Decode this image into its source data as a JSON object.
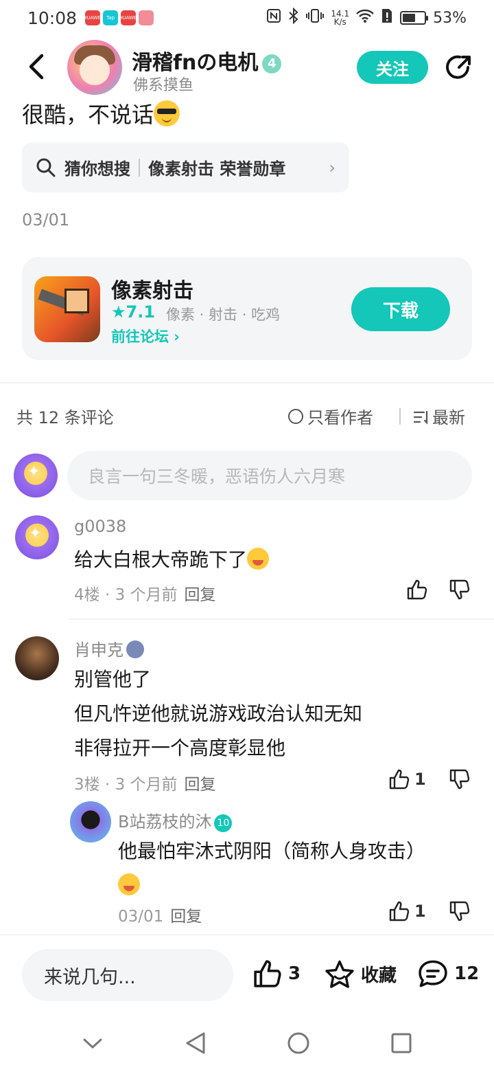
{
  "status_bar": {
    "time": "10:08",
    "net_speed_value": "14.1",
    "net_speed_unit": "K/s",
    "battery": "53%",
    "apps": [
      {
        "label": "HUAWEI",
        "color": "#e84343"
      },
      {
        "label": "Tap",
        "color": "#17c6d6"
      },
      {
        "label": "HUAWEI",
        "color": "#e84343"
      },
      {
        "label": "",
        "color": "#f28c96"
      }
    ]
  },
  "header": {
    "author_name": "滑稽fnの电机",
    "author_level": "4",
    "author_signature": "佛系摸鱼",
    "follow_label": "关注"
  },
  "post": {
    "text": "很酷，不说话",
    "search_prefix": "猜你想搜",
    "search_term": "像素射击 荣誉勋章",
    "date": "03/01"
  },
  "game_card": {
    "title": "像素射击",
    "rating": "★7.1",
    "tags": "像素 · 射击 · 吃鸡",
    "forum_link": "前往论坛 ›",
    "download_label": "下载"
  },
  "comments_header": {
    "count": "共 12 条评论",
    "author_only": "只看作者",
    "sort": "最新"
  },
  "comment_input": {
    "placeholder": "良言一句三冬暖，恶语伤人六月寒"
  },
  "comments": [
    {
      "name": "g0038",
      "text": "给大白根大帝跪下了",
      "floor": "4楼",
      "time": "3 个月前",
      "reply_label": "回复",
      "likes": ""
    },
    {
      "name": "肖申克",
      "lines": [
        "别管他了",
        "但凡忤逆他就说游戏政治认知无知",
        "非得拉开一个高度彰显他"
      ],
      "floor": "3楼",
      "time": "3 个月前",
      "reply_label": "回复",
      "likes": "1",
      "reply": {
        "name": "B站荔枝的沐",
        "level": "10",
        "text": "他最怕牢沐式阴阳（简称人身攻击）",
        "date": "03/01",
        "reply_label": "回复",
        "likes": "1"
      }
    }
  ],
  "bottom_bar": {
    "input_placeholder": "来说几句...",
    "like_count": "3",
    "favorite_label": "收藏",
    "comment_count": "12"
  },
  "nav": {
    "icons": [
      "chevron-down-icon",
      "back-triangle-icon",
      "home-circle-icon",
      "recents-square-icon"
    ]
  }
}
